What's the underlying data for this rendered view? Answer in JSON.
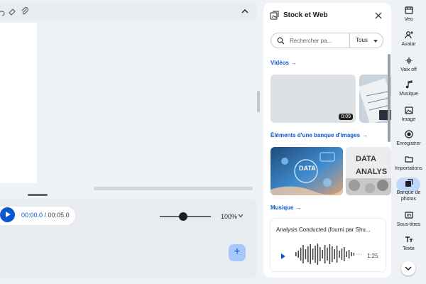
{
  "toolbar": {
    "icons": [
      "undo-icon",
      "eraser-icon",
      "attachment-icon"
    ],
    "collapse_icon": "chevron-up-icon"
  },
  "player": {
    "current_time": "00:00.0",
    "separator": " / ",
    "total_time": "00:05.0",
    "zoom": "100%",
    "zoom_slider_fraction": 0.45
  },
  "add_button": {
    "label": "+"
  },
  "stock_panel": {
    "title": "Stock et Web",
    "search": {
      "placeholder": "Rechercher pa...",
      "filter_value": "Tous"
    },
    "sections": {
      "videos": {
        "label": "Vidéos",
        "arrow": "→"
      },
      "images": {
        "label": "Éléments d'une banque d'images",
        "arrow": "→"
      },
      "music": {
        "label": "Musique",
        "arrow": "→"
      }
    },
    "video_thumbs": [
      {
        "duration": "0:09"
      },
      {
        "duration": ""
      }
    ],
    "image_thumbs": [
      {
        "text": "DATA"
      },
      {
        "text": "DATA ANALYS"
      }
    ],
    "audio": {
      "title": "Analysis Conducted (fourni par Shu...",
      "duration": "1:25"
    }
  },
  "rail": {
    "items": [
      {
        "label": "Veo",
        "icon": "veo-icon"
      },
      {
        "label": "Avatar",
        "icon": "avatar-icon"
      },
      {
        "label": "Voix off",
        "icon": "voiceover-icon"
      },
      {
        "label": "Musique",
        "icon": "music-icon"
      },
      {
        "label": "Image",
        "icon": "image-icon"
      },
      {
        "label": "Enregistrer",
        "icon": "record-icon"
      },
      {
        "label": "Importations",
        "icon": "folder-icon"
      },
      {
        "label": "Banque de photos",
        "icon": "stock-photo-icon",
        "active": true
      },
      {
        "label": "Sous-titres",
        "icon": "subtitles-icon"
      },
      {
        "label": "Texte",
        "icon": "text-icon"
      }
    ]
  },
  "colors": {
    "accent": "#0b57d0",
    "active_bg": "#c2d8fb",
    "background": "#eef1f6"
  }
}
